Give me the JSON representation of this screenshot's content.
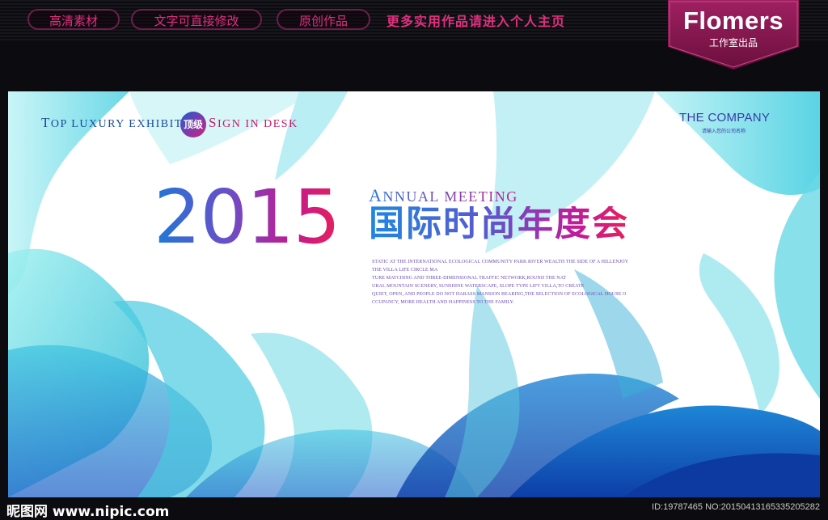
{
  "header": {
    "pills": [
      "高清素材",
      "文字可直接修改",
      "原创作品"
    ],
    "promo": "更多实用作品请进入个人主页",
    "badge_title": "Flomers",
    "badge_sub": "工作室出品"
  },
  "banner": {
    "tagline_left_initial": "T",
    "tagline_left_rest": "OP LUXURY EXHIBITION",
    "tag_dot": "顶级",
    "tagline_right_initial": "S",
    "tagline_right_rest": "IGN IN DESK",
    "company": "THE COMPANY",
    "company_sub": "请输入您的公司名称",
    "year": "2015",
    "annual_initial": "A",
    "annual_rest": "NNUAL MEETING",
    "cn_title": "国际时尚年度会",
    "body_lines": [
      "STATIC AT THE INTERNATIONAL ECOLOGICAL COMMUNITY PARK RIVER WEALTH THE SIDE OF A HILLENJOY",
      "THE VILLA LIFE CIRCLE MA",
      "TURE MATCHING AND THREE-DIMENSIONAL TRAFFIC NETWORK,ROUND THE NAT",
      "URAL MOUNTAIN SCENERY, SUNSHINE WATERSCAPE, SLOPE TYPE LIFT VILLA,TO CREATE",
      "QUIET, OPEN, AND PEOPLE DO NOT HARASS MANSION BEARING,THE SELECTION OF ECOLOGICAL HOUSE O",
      "CCUPANCY, MORE HEALTH AND HAPPINESS TO THE FAMILY."
    ]
  },
  "footer": {
    "site": "昵图网 www.nipic.com",
    "id_text": "ID:19787465 NO:20150413165335205282"
  },
  "colors": {
    "accent_pink": "#e0307e",
    "badge_bg": "#8a1a52",
    "teal": "#2ec4d6",
    "deep_blue": "#1a5cc8"
  }
}
